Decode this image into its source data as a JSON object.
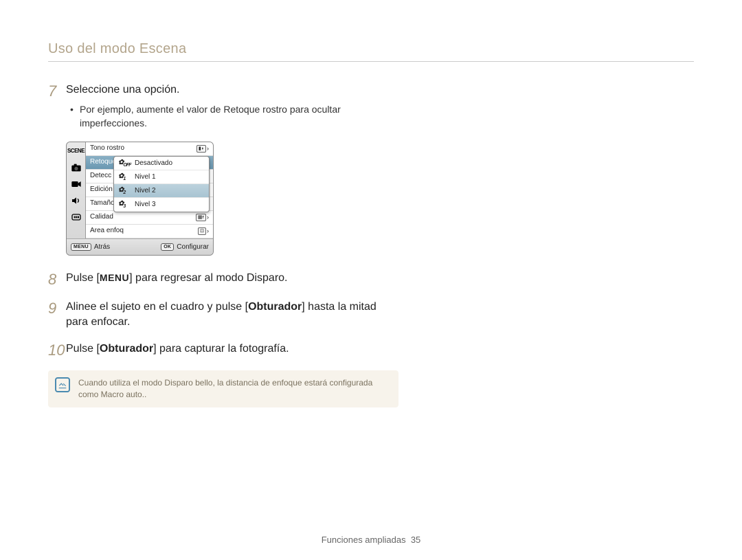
{
  "page": {
    "title": "Uso del modo Escena",
    "footer_section": "Funciones ampliadas",
    "page_number": "35"
  },
  "steps": {
    "s7": {
      "num": "7",
      "title": "Seleccione una opción.",
      "bullet": "Por ejemplo, aumente el valor de Retoque rostro para ocultar imperfecciones."
    },
    "s8": {
      "num": "8",
      "pre": "Pulse [",
      "menu_label": "MENU",
      "post": "] para regresar al modo Disparo."
    },
    "s9": {
      "num": "9",
      "pre": "Alinee el sujeto en el cuadro y pulse [",
      "bold": "Obturador",
      "post": "] hasta la mitad para enfocar."
    },
    "s10": {
      "num": "10",
      "pre": "Pulse [",
      "bold": "Obturador",
      "post": "] para capturar la fotografía."
    }
  },
  "camera_ui": {
    "side_scene": "SCENE",
    "menu": {
      "r0": "Tono rostro",
      "r1": "Retoque",
      "r2": "Detecc r",
      "r3": "Edición i",
      "r4": "Tamaño",
      "r5": "Calidad",
      "r6": "Area enfoq"
    },
    "submenu": {
      "off_label": "Desactivado",
      "off_icon": "OFF",
      "l1": "Nivel 1",
      "l2": "Nivel 2",
      "l3": "Nivel 3"
    },
    "footer": {
      "menu_btn": "MENU",
      "back": "Atrás",
      "ok_btn": "OK",
      "configure": "Configurar"
    }
  },
  "note": {
    "text": "Cuando utiliza el modo Disparo bello, la distancia de enfoque estará configurada como Macro auto.."
  }
}
